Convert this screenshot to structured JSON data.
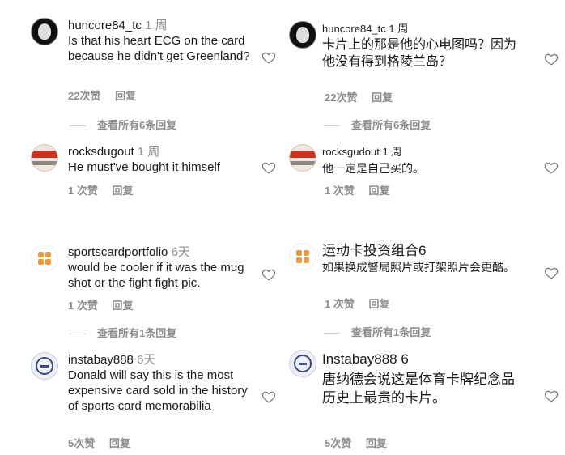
{
  "left": {
    "comments": [
      {
        "user": "huncore84_tc",
        "time": "1 周",
        "text": "Is that his heart ECG on the card because he didn't get Greenland?",
        "likes": "22次赞",
        "reply": "回复",
        "view_replies": "查看所有6条回复"
      },
      {
        "user": "rocksdugout",
        "time": "1 周",
        "text": "He must've bought it himself",
        "likes": "1 次赞",
        "reply": "回复"
      },
      {
        "user": "sportscardportfolio",
        "time": "6天",
        "text": "would be cooler if it was the mug shot or the fight fight pic.",
        "likes": "1 次赞",
        "reply": "回复",
        "view_replies": "查看所有1条回复"
      },
      {
        "user": "instabay888",
        "time": "6天",
        "text": "Donald will say this is the most expensive card sold in the history of sports card memorabilia",
        "likes": "5次赞",
        "reply": "回复"
      }
    ]
  },
  "right": {
    "comments": [
      {
        "user": "huncore84_tc",
        "time": "1 周",
        "text": "卡片上的那是他的心电图吗？因为他没有得到格陵兰岛？",
        "likes": "22次赞",
        "reply": "回复",
        "view_replies": "查看所有6条回复"
      },
      {
        "user": "rocksgudout",
        "time": "1 周",
        "text": "他一定是自己买的。",
        "likes": "1 次赞",
        "reply": "回复"
      },
      {
        "user": "运动卡投资组合6",
        "time": "",
        "text": "如果换成警局照片或打架照片会更酷。",
        "likes": "1 次赞",
        "reply": "回复",
        "view_replies": "查看所有1条回复"
      },
      {
        "user": "Instabay888 6",
        "time": "",
        "text": "唐纳德会说这是体育卡牌纪念品历史上最贵的卡片。",
        "likes": "5次赞",
        "reply": "回复"
      }
    ]
  },
  "icons": {
    "like": "heart-outline-icon"
  },
  "colors": {
    "secondary_text": "#8e8e8e",
    "divider": "#cfcfcf"
  }
}
